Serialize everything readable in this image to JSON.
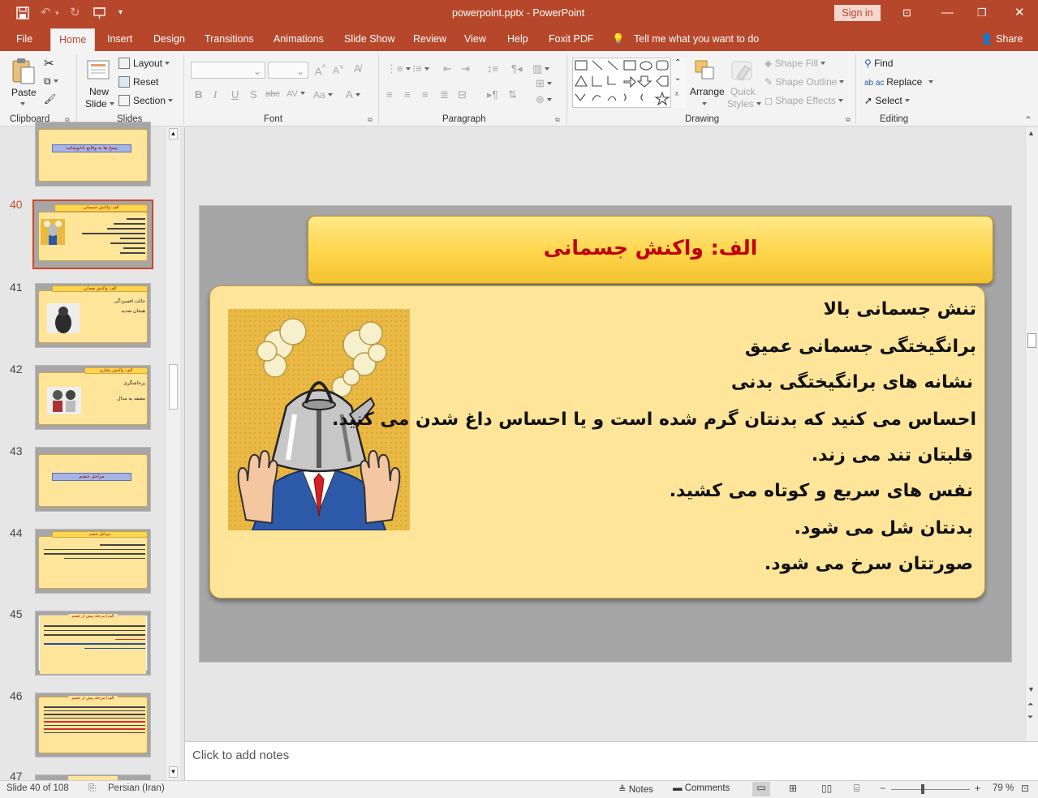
{
  "window": {
    "title": "powerpoint.pptx  -  PowerPoint",
    "sign_in": "Sign in"
  },
  "tabs": [
    "File",
    "Home",
    "Insert",
    "Design",
    "Transitions",
    "Animations",
    "Slide Show",
    "Review",
    "View",
    "Help",
    "Foxit PDF"
  ],
  "tell_me": "Tell me what you want to do",
  "share": "Share",
  "ribbon": {
    "clipboard": {
      "paste": "Paste",
      "label": "Clipboard"
    },
    "slides": {
      "new_slide_1": "New",
      "new_slide_2": "Slide",
      "layout": "Layout",
      "reset": "Reset",
      "section": "Section",
      "label": "Slides"
    },
    "font": {
      "label": "Font",
      "bold": "B",
      "italic": "I",
      "underline": "U",
      "shadow": "S",
      "strike": "abc",
      "spacing": "AV",
      "case": "Aa",
      "color": "A"
    },
    "paragraph": {
      "label": "Paragraph"
    },
    "drawing": {
      "arrange": "Arrange",
      "quick_styles_1": "Quick",
      "quick_styles_2": "Styles",
      "shape_fill": "Shape Fill",
      "shape_outline": "Shape Outline",
      "shape_effects": "Shape Effects",
      "label": "Drawing"
    },
    "editing": {
      "find": "Find",
      "replace": "Replace",
      "select": "Select",
      "label": "Editing"
    }
  },
  "thumbnails": [
    {
      "num": "",
      "title": "پسخ ها به وقایع ناخوشایند"
    },
    {
      "num": "40",
      "title": "الف: واکنش جسمانی"
    },
    {
      "num": "41",
      "title": "الف: واکنش هیجانی",
      "text1": "حالت افسردگی",
      "text2": "هیجان شدید"
    },
    {
      "num": "42",
      "title": "الف: واکنش رفتاری",
      "text1": "پرخاشگری",
      "text2": "معتقد به مدال"
    },
    {
      "num": "43",
      "title": "مراحل خشم"
    },
    {
      "num": "44",
      "title": "مراحل خشم"
    },
    {
      "num": "45",
      "title": "الف) مرحله پیش از خشم"
    },
    {
      "num": "46",
      "title": "الف) مرحله پیش از خشم"
    },
    {
      "num": "47",
      "title": ""
    }
  ],
  "slide": {
    "title": "الف: واکنش جسمانی",
    "lines": [
      "تنش جسمانی  بالا",
      "برانگیختگی جسمانی عمیق",
      "نشانه های برانگیختگی بدنی",
      "احساس می کنید که بدنتان گرم شده است و یا احساس داغ شدن می کنید.",
      "قلبتان تند می زند.",
      "نفس های سریع و کوتاه می کشید.",
      "بدنتان شل می شود.",
      "صورتتان سرخ می شود."
    ]
  },
  "notes_placeholder": "Click to add notes",
  "status": {
    "slide_info": "Slide 40 of 108",
    "language": "Persian (Iran)",
    "notes": "Notes",
    "comments": "Comments",
    "zoom": "79 %",
    "zoom_fraction": 0.4
  },
  "colors": {
    "accent": "#b7472a",
    "slide_bg": "#a6a6a6",
    "title_box": "#ffd54a",
    "content_box": "#ffe599",
    "title_text": "#c00000"
  }
}
